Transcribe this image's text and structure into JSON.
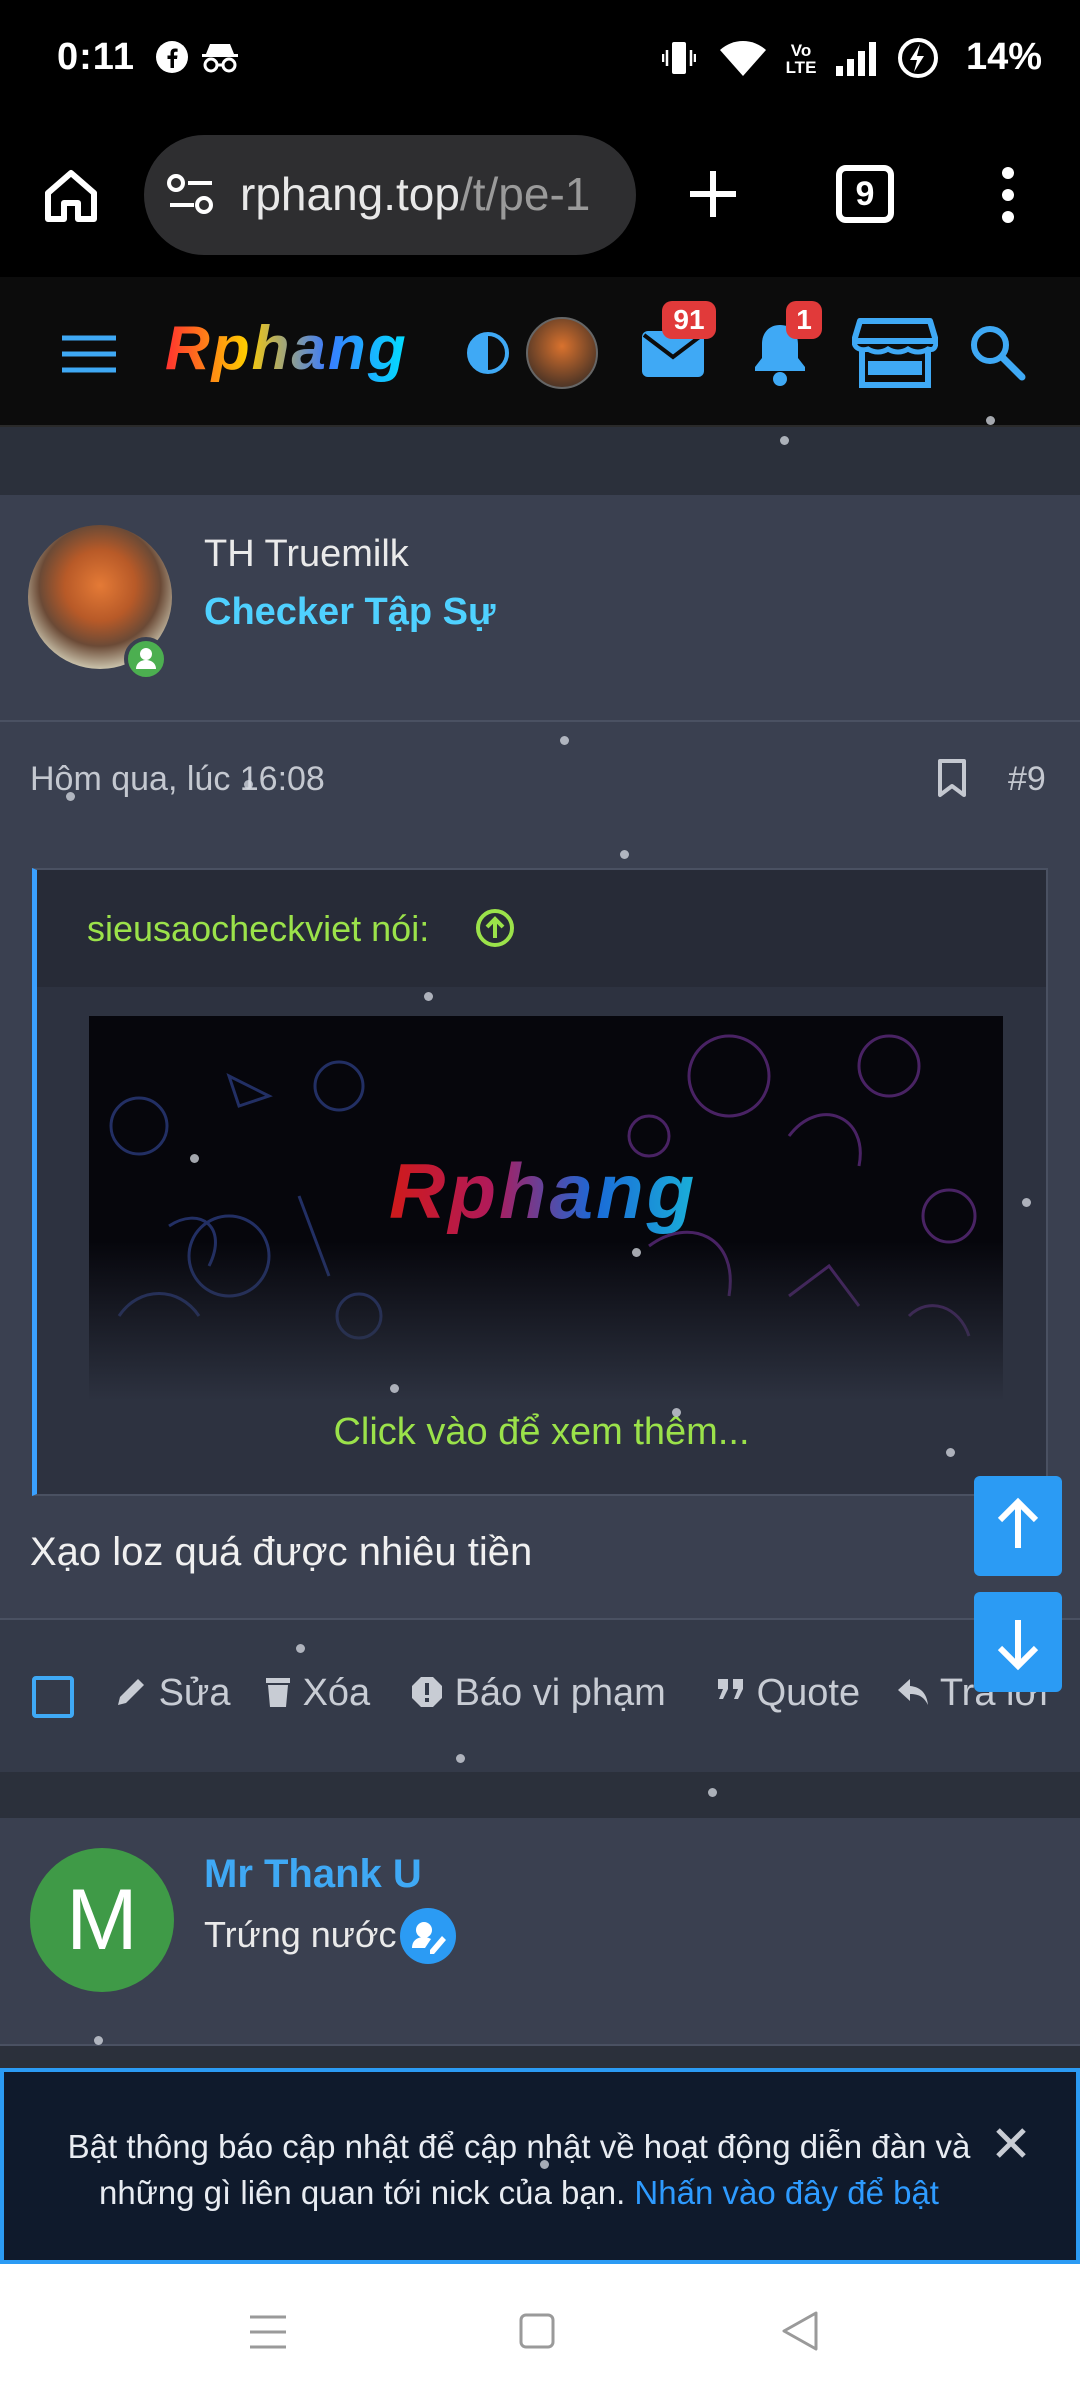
{
  "status_bar": {
    "time": "0:11",
    "battery": "14%",
    "volte_label": "Vo LTE",
    "icons": [
      "facebook-icon",
      "incognito-icon",
      "vibrate-icon",
      "wifi-icon",
      "signal-icon",
      "battery-charging-icon"
    ]
  },
  "browser": {
    "url_domain": "rphang.top",
    "url_path": "/t/pe-1",
    "tab_count": "9"
  },
  "forum_header": {
    "logo_text": "Rphang",
    "messages_badge": "91",
    "alerts_badge": "1"
  },
  "post": {
    "author": "TH Truemilk",
    "author_title": "Checker Tập Sự",
    "timestamp": "Hôm qua, lúc 16:08",
    "post_number": "#9",
    "quote_author": "sieusaocheckviet nói:",
    "quote_banner_logo": "Rphang",
    "quote_expand": "Click vào để xem thêm...",
    "body": "Xạo loz quá được nhiêu tiền",
    "actions": {
      "edit": "Sửa",
      "delete": "Xóa",
      "report": "Báo vi phạm",
      "quote": "Quote",
      "reply": "Trả lời"
    }
  },
  "next_post": {
    "avatar_letter": "M",
    "author": "Mr Thank U",
    "author_title": "Trứng nước"
  },
  "notification": {
    "text": "Bật thông báo cập nhật để cập nhật về hoạt động diễn đàn và những gì liên quan tới nick của bạn.",
    "link": "Nhấn vào đây để bật"
  },
  "colors": {
    "accent_blue": "#2b9bf4",
    "title_cyan": "#4fd1ff",
    "quote_green": "#9be24a",
    "badge_red": "#e13a3a",
    "online_green": "#4caf50"
  }
}
